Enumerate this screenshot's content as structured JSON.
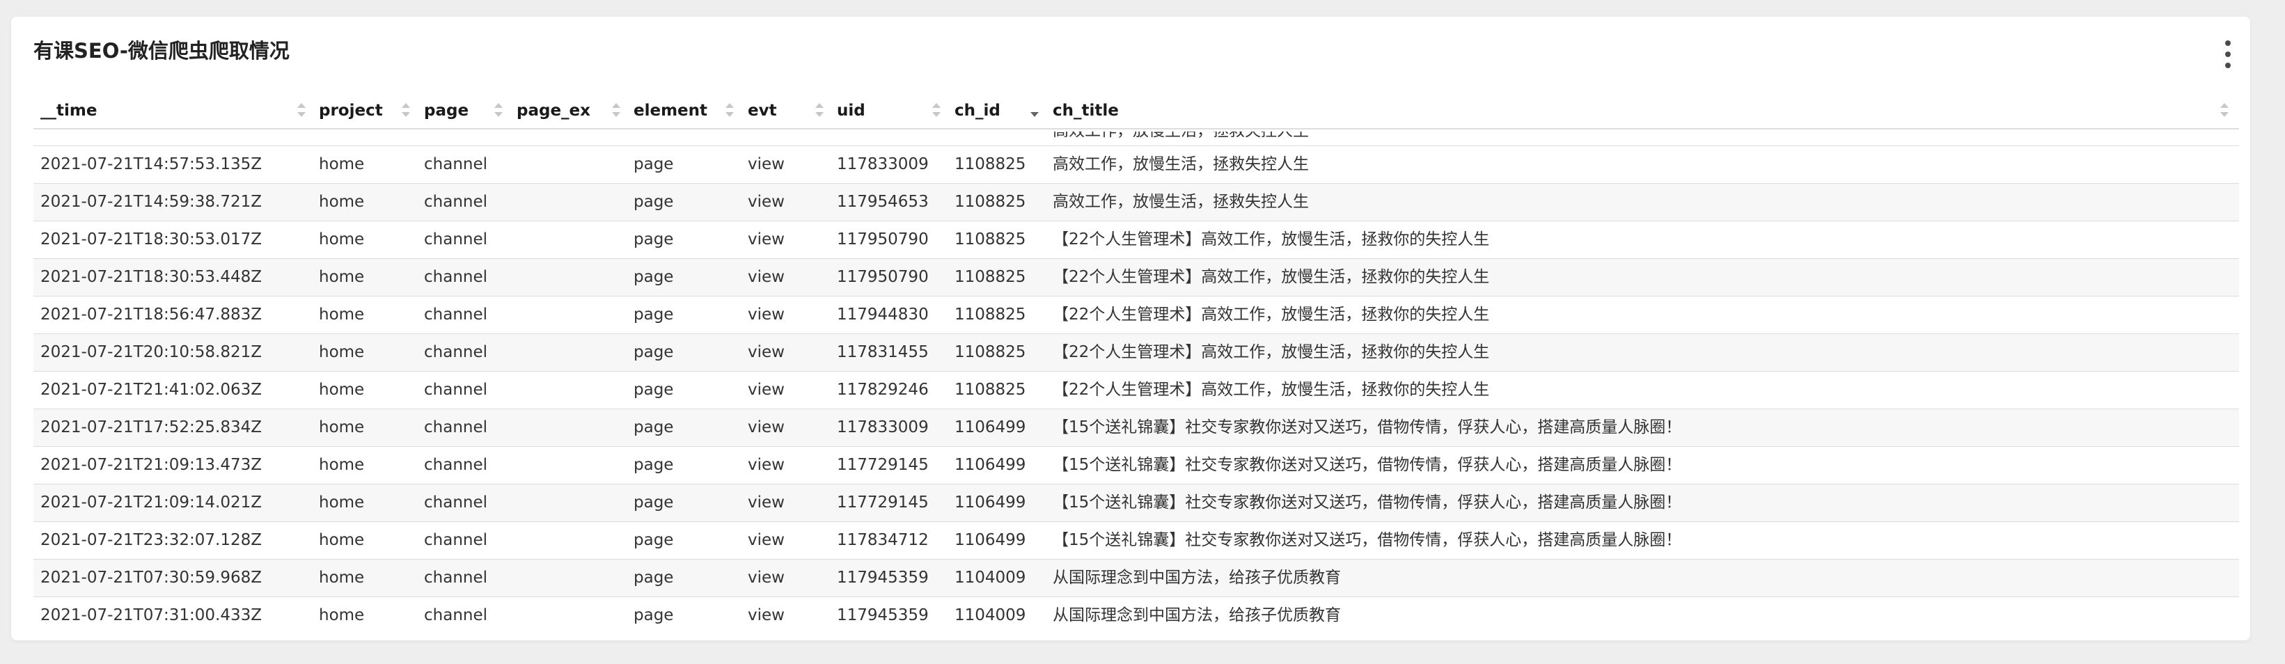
{
  "title": "有课SEO-微信爬虫爬取情况",
  "columns": {
    "time": "__time",
    "project": "project",
    "page": "page",
    "page_ex": "page_ex",
    "element": "element",
    "evt": "evt",
    "uid": "uid",
    "ch_id": "ch_id",
    "ch_title": "ch_title"
  },
  "partial_row": {
    "ch_title": "高效工作，放慢生活，拯救失控人生"
  },
  "rows": [
    {
      "time": "2021-07-21T14:57:53.135Z",
      "project": "home",
      "page": "channel",
      "page_ex": "",
      "element": "page",
      "evt": "view",
      "uid": "117833009",
      "ch_id": "1108825",
      "ch_title": "高效工作，放慢生活，拯救失控人生"
    },
    {
      "time": "2021-07-21T14:59:38.721Z",
      "project": "home",
      "page": "channel",
      "page_ex": "",
      "element": "page",
      "evt": "view",
      "uid": "117954653",
      "ch_id": "1108825",
      "ch_title": "高效工作，放慢生活，拯救失控人生"
    },
    {
      "time": "2021-07-21T18:30:53.017Z",
      "project": "home",
      "page": "channel",
      "page_ex": "",
      "element": "page",
      "evt": "view",
      "uid": "117950790",
      "ch_id": "1108825",
      "ch_title": "【22个人生管理术】高效工作，放慢生活，拯救你的失控人生"
    },
    {
      "time": "2021-07-21T18:30:53.448Z",
      "project": "home",
      "page": "channel",
      "page_ex": "",
      "element": "page",
      "evt": "view",
      "uid": "117950790",
      "ch_id": "1108825",
      "ch_title": "【22个人生管理术】高效工作，放慢生活，拯救你的失控人生"
    },
    {
      "time": "2021-07-21T18:56:47.883Z",
      "project": "home",
      "page": "channel",
      "page_ex": "",
      "element": "page",
      "evt": "view",
      "uid": "117944830",
      "ch_id": "1108825",
      "ch_title": "【22个人生管理术】高效工作，放慢生活，拯救你的失控人生"
    },
    {
      "time": "2021-07-21T20:10:58.821Z",
      "project": "home",
      "page": "channel",
      "page_ex": "",
      "element": "page",
      "evt": "view",
      "uid": "117831455",
      "ch_id": "1108825",
      "ch_title": "【22个人生管理术】高效工作，放慢生活，拯救你的失控人生"
    },
    {
      "time": "2021-07-21T21:41:02.063Z",
      "project": "home",
      "page": "channel",
      "page_ex": "",
      "element": "page",
      "evt": "view",
      "uid": "117829246",
      "ch_id": "1108825",
      "ch_title": "【22个人生管理术】高效工作，放慢生活，拯救你的失控人生"
    },
    {
      "time": "2021-07-21T17:52:25.834Z",
      "project": "home",
      "page": "channel",
      "page_ex": "",
      "element": "page",
      "evt": "view",
      "uid": "117833009",
      "ch_id": "1106499",
      "ch_title": "【15个送礼锦囊】社交专家教你送对又送巧，借物传情，俘获人心，搭建高质量人脉圈！"
    },
    {
      "time": "2021-07-21T21:09:13.473Z",
      "project": "home",
      "page": "channel",
      "page_ex": "",
      "element": "page",
      "evt": "view",
      "uid": "117729145",
      "ch_id": "1106499",
      "ch_title": "【15个送礼锦囊】社交专家教你送对又送巧，借物传情，俘获人心，搭建高质量人脉圈！"
    },
    {
      "time": "2021-07-21T21:09:14.021Z",
      "project": "home",
      "page": "channel",
      "page_ex": "",
      "element": "page",
      "evt": "view",
      "uid": "117729145",
      "ch_id": "1106499",
      "ch_title": "【15个送礼锦囊】社交专家教你送对又送巧，借物传情，俘获人心，搭建高质量人脉圈！"
    },
    {
      "time": "2021-07-21T23:32:07.128Z",
      "project": "home",
      "page": "channel",
      "page_ex": "",
      "element": "page",
      "evt": "view",
      "uid": "117834712",
      "ch_id": "1106499",
      "ch_title": "【15个送礼锦囊】社交专家教你送对又送巧，借物传情，俘获人心，搭建高质量人脉圈！"
    },
    {
      "time": "2021-07-21T07:30:59.968Z",
      "project": "home",
      "page": "channel",
      "page_ex": "",
      "element": "page",
      "evt": "view",
      "uid": "117945359",
      "ch_id": "1104009",
      "ch_title": "从国际理念到中国方法，给孩子优质教育"
    },
    {
      "time": "2021-07-21T07:31:00.433Z",
      "project": "home",
      "page": "channel",
      "page_ex": "",
      "element": "page",
      "evt": "view",
      "uid": "117945359",
      "ch_id": "1104009",
      "ch_title": "从国际理念到中国方法，给孩子优质教育"
    }
  ]
}
